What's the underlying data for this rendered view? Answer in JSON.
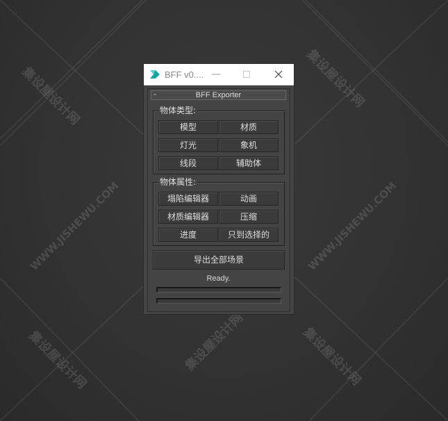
{
  "window": {
    "title": "BFF v0....",
    "minimize_glyph": "—",
    "maximize_glyph": "☐",
    "close_glyph": "✕",
    "app_icon": "3ds-max-icon"
  },
  "rollout": {
    "toggle": "-",
    "title": "BFF Exporter"
  },
  "object_types": {
    "label": "物体类型:",
    "buttons": [
      "模型",
      "材质",
      "灯光",
      "象机",
      "线段",
      "辅助体"
    ]
  },
  "object_props": {
    "label": "物体属性:",
    "buttons": [
      "塌陷编辑器",
      "动画",
      "材质编辑器",
      "压缩",
      "进度",
      "只到选择的"
    ]
  },
  "export_button": "导出全部场景",
  "status": "Ready.",
  "progress": [
    0,
    0
  ],
  "watermark": {
    "cn": "集设屋设计网",
    "en": "WWW.JISHEWU.COM"
  },
  "colors": {
    "panel": "#444444",
    "button": "#3b3b3b",
    "text": "#dedede",
    "titlebar": "#ffffff"
  }
}
